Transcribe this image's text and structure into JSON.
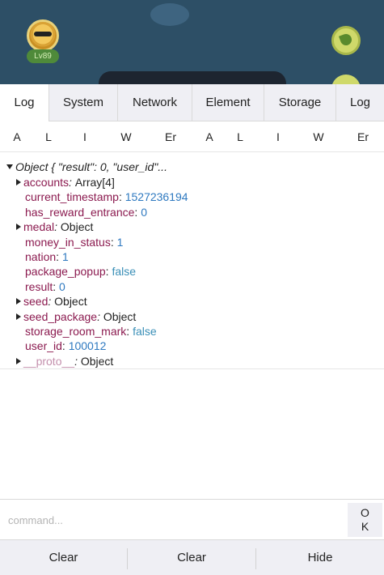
{
  "game": {
    "level": "Lv89"
  },
  "tabs": [
    "Log",
    "System",
    "Network",
    "Element",
    "Storage",
    "Log"
  ],
  "filters": [
    "A",
    "L",
    "I",
    "W",
    "Er",
    "A",
    "L",
    "I",
    "W",
    "Er"
  ],
  "log": {
    "header": "Object { \"result\": 0, \"user_id\"...",
    "entries": [
      {
        "key": "accounts",
        "sep": ": ",
        "value": "Array[4]",
        "type": "val",
        "expandable": true,
        "italicSep": true
      },
      {
        "key": "current_timestamp",
        "sep": ": ",
        "value": "1527236194",
        "type": "num",
        "expandable": false
      },
      {
        "key": "has_reward_entrance",
        "sep": ": ",
        "value": "0",
        "type": "num",
        "expandable": false
      },
      {
        "key": "medal",
        "sep": ": ",
        "value": "Object",
        "type": "val",
        "expandable": true,
        "italicSep": true
      },
      {
        "key": "money_in_status",
        "sep": ": ",
        "value": "1",
        "type": "num",
        "expandable": false
      },
      {
        "key": "nation",
        "sep": ": ",
        "value": "1",
        "type": "num",
        "expandable": false
      },
      {
        "key": "package_popup",
        "sep": ": ",
        "value": "false",
        "type": "bool",
        "expandable": false
      },
      {
        "key": "result",
        "sep": ": ",
        "value": "0",
        "type": "num",
        "expandable": false
      },
      {
        "key": "seed",
        "sep": ": ",
        "value": "Object",
        "type": "val",
        "expandable": true,
        "italicSep": true
      },
      {
        "key": "seed_package",
        "sep": ": ",
        "value": "Object",
        "type": "val",
        "expandable": true,
        "italicSep": true
      },
      {
        "key": "storage_room_mark",
        "sep": ": ",
        "value": "false",
        "type": "bool",
        "expandable": false
      },
      {
        "key": "user_id",
        "sep": ": ",
        "value": "100012",
        "type": "num",
        "expandable": false
      },
      {
        "key": "__proto__",
        "sep": ": ",
        "value": "Object",
        "type": "val",
        "expandable": true,
        "italicSep": true,
        "dim": true
      }
    ]
  },
  "command": {
    "placeholder": "command...",
    "ok_line1": "O",
    "ok_line2": "K"
  },
  "bottom": {
    "clear1": "Clear",
    "clear2": "Clear",
    "hide": "Hide"
  },
  "colors": {
    "key": "#8b1a4f",
    "number": "#2e79c0",
    "boolean": "#3a8fb7",
    "toolbar": "#efeff4"
  }
}
